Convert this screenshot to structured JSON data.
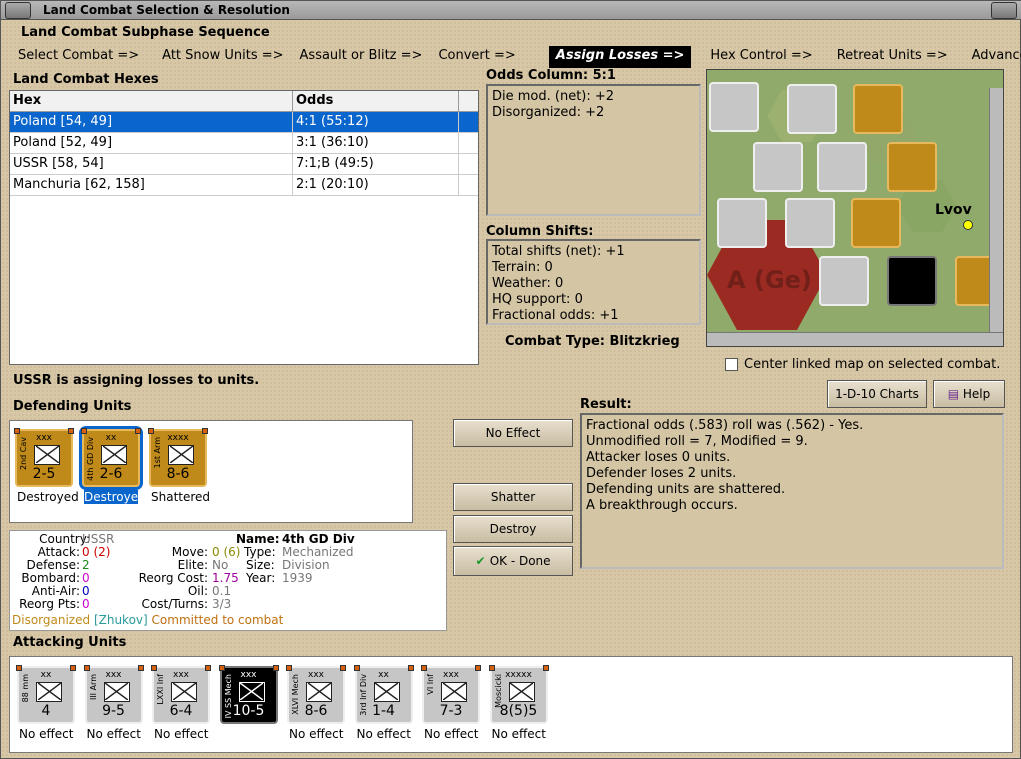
{
  "window": {
    "title": "Land Combat Selection & Resolution"
  },
  "subphase": {
    "title": "Land Combat Subphase Sequence",
    "steps": [
      "Select Combat =>",
      "Att Snow Units =>",
      "Assault or Blitz =>",
      "Convert =>",
      "Assign Losses =>",
      "Hex Control =>",
      "Retreat Units =>",
      "Advance Units"
    ],
    "active": 4
  },
  "hexes": {
    "title": "Land Combat Hexes",
    "col_hex": "Hex",
    "col_odds": "Odds",
    "rows": [
      {
        "hex": "Poland [54, 49]",
        "odds": "4:1 (55:12)"
      },
      {
        "hex": "Poland [52, 49]",
        "odds": "3:1 (36:10)"
      },
      {
        "hex": "USSR [58, 54]",
        "odds": "7:1;B (49:5)"
      },
      {
        "hex": "Manchuria [62, 158]",
        "odds": "2:1 (20:10)"
      }
    ]
  },
  "odds": {
    "title": "Odds Column: 5:1",
    "lines": [
      "Die mod. (net): +2",
      "Disorganized: +2"
    ]
  },
  "shifts": {
    "title": "Column Shifts:",
    "lines": [
      "Total shifts (net): +1",
      "Terrain: 0",
      "Weather: 0",
      "HQ support: 0",
      "Fractional odds: +1"
    ]
  },
  "combat_type": "Combat Type:  Blitzkrieg",
  "map": {
    "city": "Lvov",
    "region": "A (Ge)",
    "center_label": "Center linked map on selected combat."
  },
  "status": "USSR is assigning losses to units.",
  "defending": {
    "title": "Defending Units",
    "units": [
      {
        "name": "2nd Cav",
        "size": "xxx",
        "str": "2-5",
        "status": "Destroyed",
        "color": "orange",
        "sel": false
      },
      {
        "name": "4th GD Div",
        "size": "xx",
        "str": "2-6",
        "status": "Destroyed",
        "color": "orange",
        "sel": true
      },
      {
        "name": "1st Arm",
        "size": "xxxx",
        "str": "8-6",
        "status": "Shattered",
        "color": "orange",
        "sel": false
      }
    ]
  },
  "buttons": {
    "no_effect": "No Effect",
    "shatter": "Shatter",
    "destroy": "Destroy",
    "ok": "OK - Done",
    "charts": "1-D-10 Charts",
    "help": "Help"
  },
  "result": {
    "title": "Result:",
    "lines": [
      "Fractional odds (.583) roll was (.562)  - Yes.",
      "Unmodified roll = 7, Modified = 9.",
      "Attacker loses 0 units.",
      "Defender loses 2 units.",
      "Defending units are shattered.",
      "A breakthrough occurs."
    ]
  },
  "info": {
    "country_l": "Country:",
    "country_v": "USSR",
    "attack_l": "Attack:",
    "attack_v": "0",
    "attack_v2": "(2)",
    "defense_l": "Defense:",
    "defense_v": "2",
    "bombard_l": "Bombard:",
    "bombard_v": "0",
    "antiair_l": "Anti-Air:",
    "antiair_v": "0",
    "reorg_l": "Reorg Pts:",
    "reorg_v": "0",
    "name_l": "Name:",
    "name_v": "4th GD Div",
    "move_l": "Move:",
    "move_v": "0",
    "move_v2": "(6)",
    "type_l": "Type:",
    "type_v": "Mechanized",
    "elite_l": "Elite:",
    "elite_v": "No",
    "size_l": "Size:",
    "size_v": "Division",
    "rcost_l": "Reorg Cost:",
    "rcost_v": "1.75",
    "year_l": "Year:",
    "year_v": "1939",
    "oil_l": "Oil:",
    "oil_v": "0.1",
    "ct_l": "Cost/Turns:",
    "ct_v": "3/3",
    "dis": "Disorganized",
    "hq": "[Zhukov]",
    "commit": "Committed to combat"
  },
  "attacking": {
    "title": "Attacking Units",
    "units": [
      {
        "name": "88 mm",
        "size": "xx",
        "str": "4",
        "status": "No effect",
        "color": "grey"
      },
      {
        "name": "III Arm",
        "size": "xxx",
        "str": "9-5",
        "status": "No effect",
        "color": "grey"
      },
      {
        "name": "LXXI Inf",
        "size": "xxx",
        "str": "6-4",
        "status": "No effect",
        "color": "grey"
      },
      {
        "name": "IV SS Mech",
        "size": "xxx",
        "str": "10-5",
        "status": "No effect",
        "color": "black"
      },
      {
        "name": "XLVI Mech",
        "size": "xxx",
        "str": "8-6",
        "status": "No effect",
        "color": "grey"
      },
      {
        "name": "3rd Inf Div",
        "size": "xx",
        "str": "1-4",
        "status": "No effect",
        "color": "grey"
      },
      {
        "name": "VI Inf",
        "size": "xxx",
        "str": "7-3",
        "status": "No effect",
        "color": "grey"
      },
      {
        "name": "Moscicki",
        "size": "xxxxx",
        "str": "8(5)5",
        "status": "No effect",
        "color": "grey"
      }
    ]
  }
}
